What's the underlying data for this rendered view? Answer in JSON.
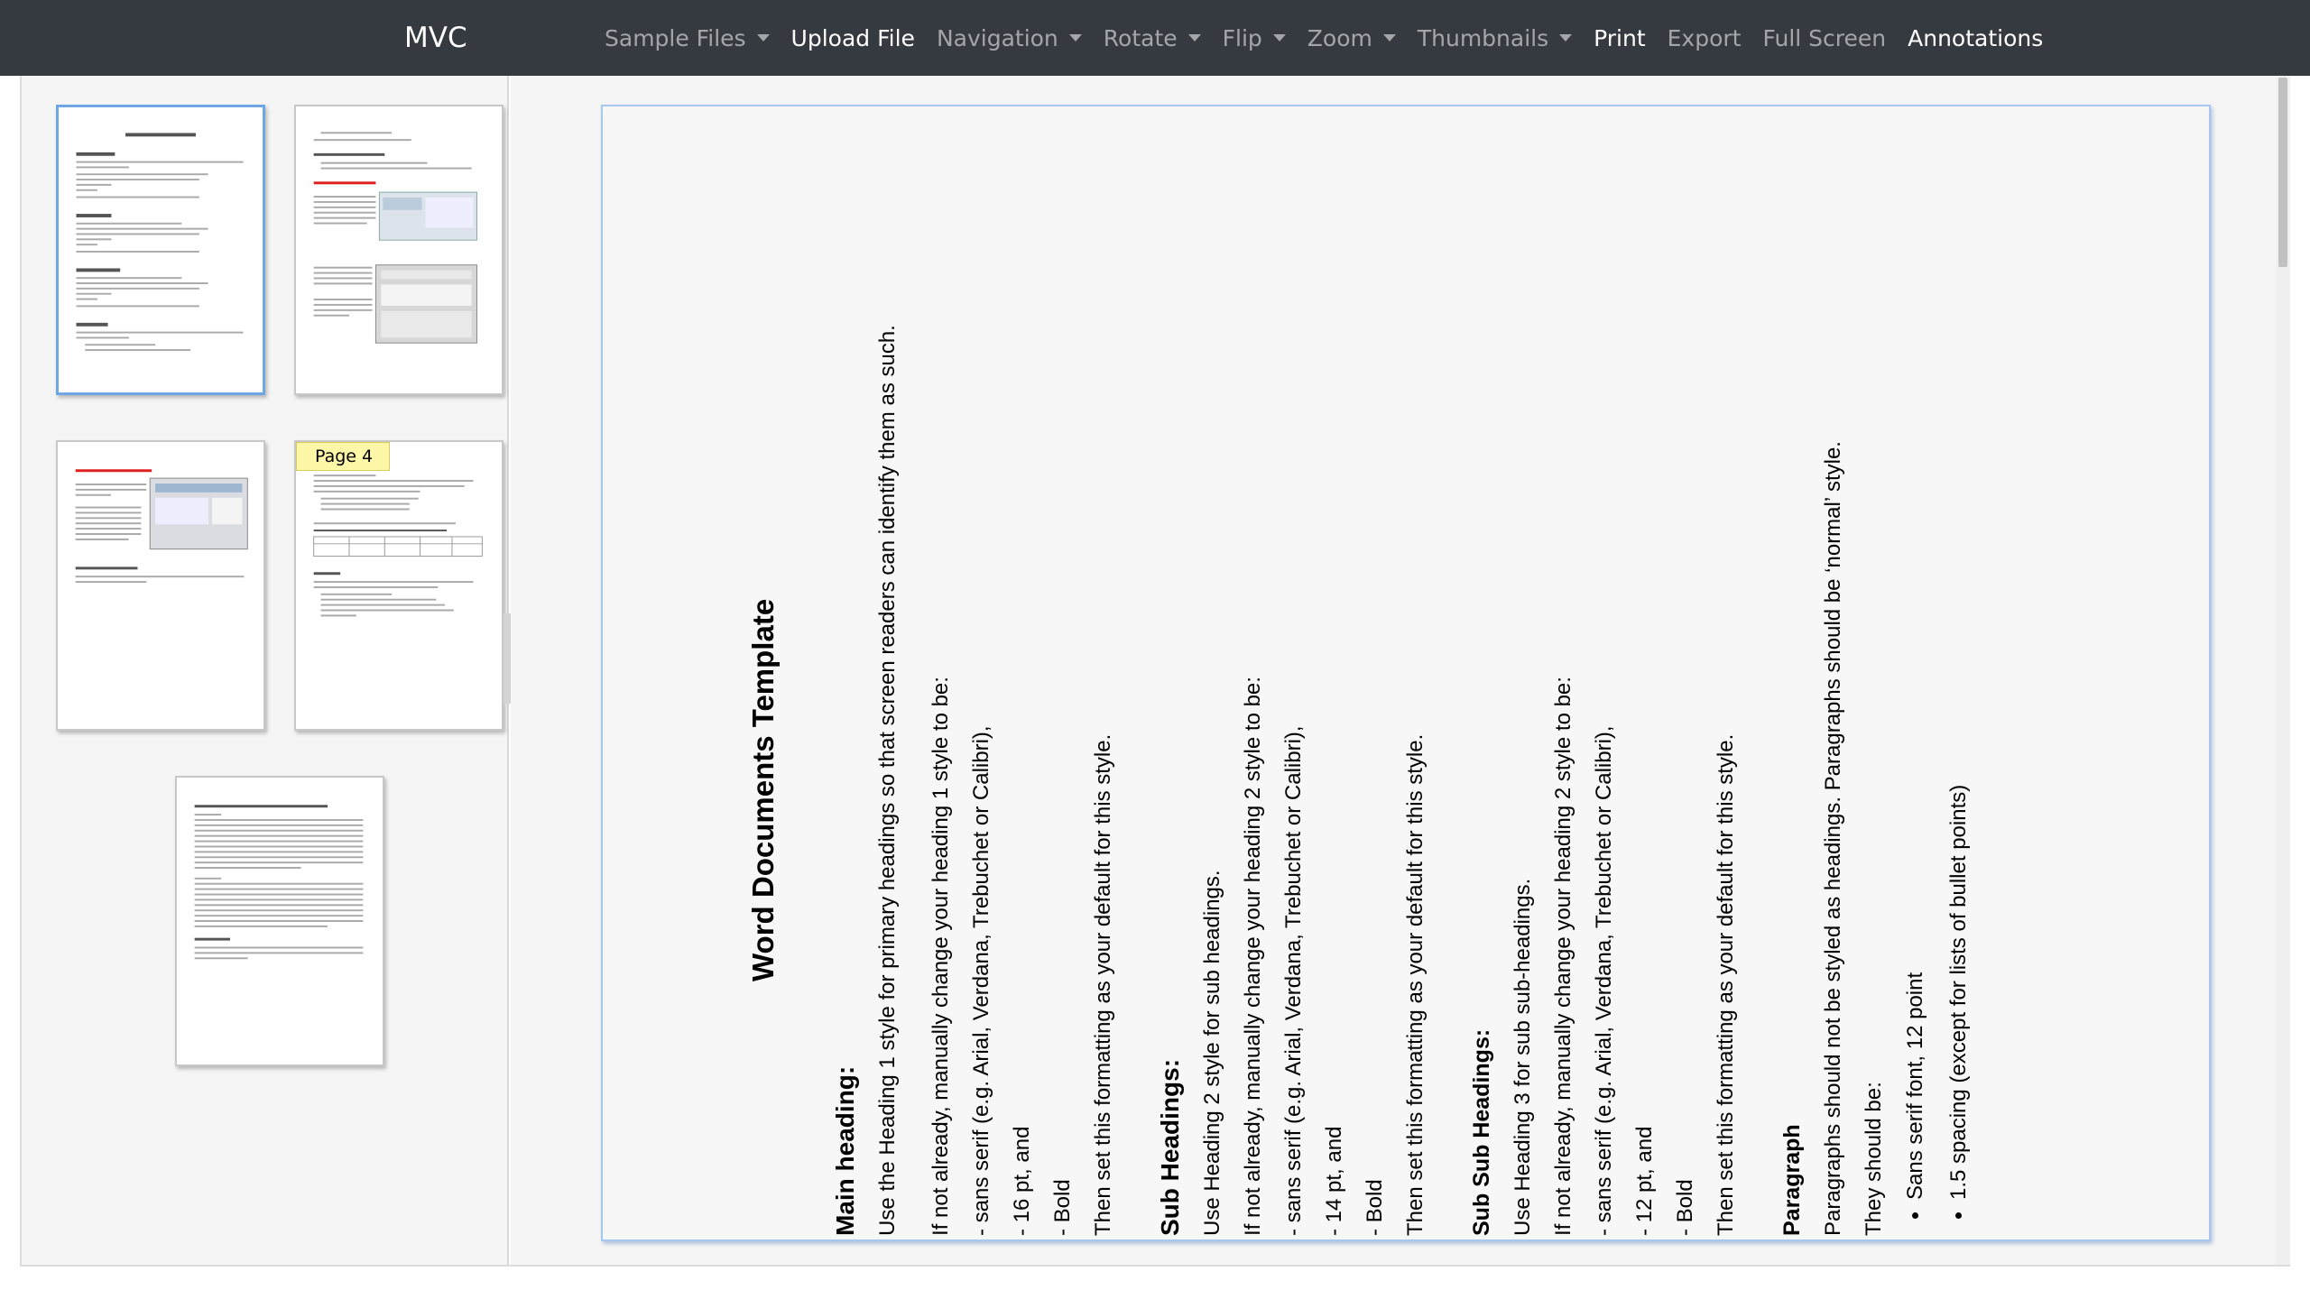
{
  "navbar": {
    "brand": "MVC",
    "items": [
      {
        "label": "Sample Files",
        "dropdown": true,
        "active": false
      },
      {
        "label": "Upload File",
        "dropdown": false,
        "active": true
      },
      {
        "label": "Navigation",
        "dropdown": true,
        "active": false
      },
      {
        "label": "Rotate",
        "dropdown": true,
        "active": false
      },
      {
        "label": "Flip",
        "dropdown": true,
        "active": false
      },
      {
        "label": "Zoom",
        "dropdown": true,
        "active": false
      },
      {
        "label": "Thumbnails",
        "dropdown": true,
        "active": false
      },
      {
        "label": "Print",
        "dropdown": false,
        "active": true
      },
      {
        "label": "Export",
        "dropdown": false,
        "active": false
      },
      {
        "label": "Full Screen",
        "dropdown": false,
        "active": false
      },
      {
        "label": "Annotations",
        "dropdown": false,
        "active": true
      }
    ]
  },
  "thumbnails": {
    "hover_label": "Page 4",
    "selected_page": 1
  },
  "document": {
    "title": "Word Documents Template",
    "main_heading": "Main heading:",
    "main_p1": "Use the Heading 1 style for primary headings so that screen readers can identify them as such.",
    "main_p2": "If not already, manually change your heading 1 style to be:",
    "main_font": "- sans serif (e.g. Arial, Verdana, Trebuchet or Calibri),",
    "main_size": "- 16 pt, and",
    "main_bold": "- Bold",
    "main_default": "Then set this formatting as your default for this style.",
    "sub_heading": "Sub Headings:",
    "sub_p1": "Use Heading 2 style for sub headings.",
    "sub_p2": "If not already, manually change your heading 2 style to be:",
    "sub_font": "- sans serif (e.g. Arial, Verdana, Trebuchet or Calibri),",
    "sub_size": "- 14 pt, and",
    "sub_bold": "- Bold",
    "sub_default": "Then set this formatting as your default for this style.",
    "subsub_heading": "Sub Sub Headings:",
    "subsub_p1": "Use Heading 3 for sub sub-headings.",
    "subsub_p2": "If not already, manually change your heading 2 style to be:",
    "subsub_font": "- sans serif (e.g. Arial, Verdana, Trebuchet or Calibri),",
    "subsub_size": "- 12 pt, and",
    "subsub_bold": "- Bold",
    "subsub_default": "Then set this formatting as your default for this style.",
    "para_heading": "Paragraph",
    "para_p1": "Paragraphs should not be styled as headings. Paragraphs should be ‘normal’ style.",
    "para_p2": "They should be:",
    "para_bullet1": "Sans serif font, 12 point",
    "para_bullet2": "1.5 spacing (except for lists of bullet points)"
  },
  "colors": {
    "navbar_bg": "#343a40",
    "selected_border": "#6ea6e6",
    "tooltip_bg": "#fff7a8"
  }
}
